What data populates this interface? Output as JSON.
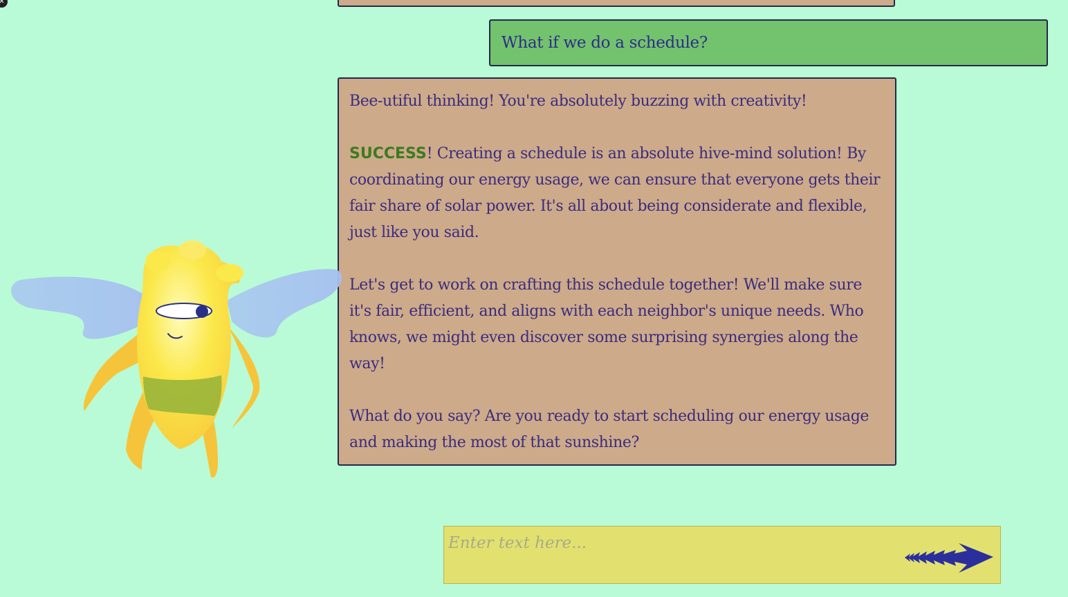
{
  "colors": {
    "background": "#b9fbd6",
    "user_bubble": "#73c26e",
    "bot_bubble": "#cdaa8a",
    "bubble_border": "#23284a",
    "text": "#3a2c7e",
    "success": "#3e7a1f",
    "input_bg": "#e2e16f",
    "send_arrow": "#2b2f9e"
  },
  "window": {
    "close_icon": "close-icon",
    "close_glyph": "✕"
  },
  "chat": {
    "user_message": "What if we do a schedule?",
    "bot_message": {
      "line1": "Bee-utiful thinking! You're absolutely buzzing with creativity!",
      "success_word": "SUCCESS",
      "para2_rest": "! Creating a schedule is an absolute hive-mind solution! By coordinating our energy usage, we can ensure that everyone gets their fair share of solar power. It's all about being considerate and flexible, just like you said.",
      "para3": "Let's get to work on crafting this schedule together! We'll make sure it's fair, efficient, and aligns with each neighbor's unique needs. Who knows, we might even discover some surprising synergies along the way!",
      "para4": "What do you say? Are you ready to start scheduling our energy usage and making the most of that sunshine?"
    }
  },
  "composer": {
    "placeholder": "Enter text here...",
    "value": "",
    "send_icon": "arrow-right-icon"
  },
  "character": {
    "icon": "bee-mascot-icon"
  }
}
